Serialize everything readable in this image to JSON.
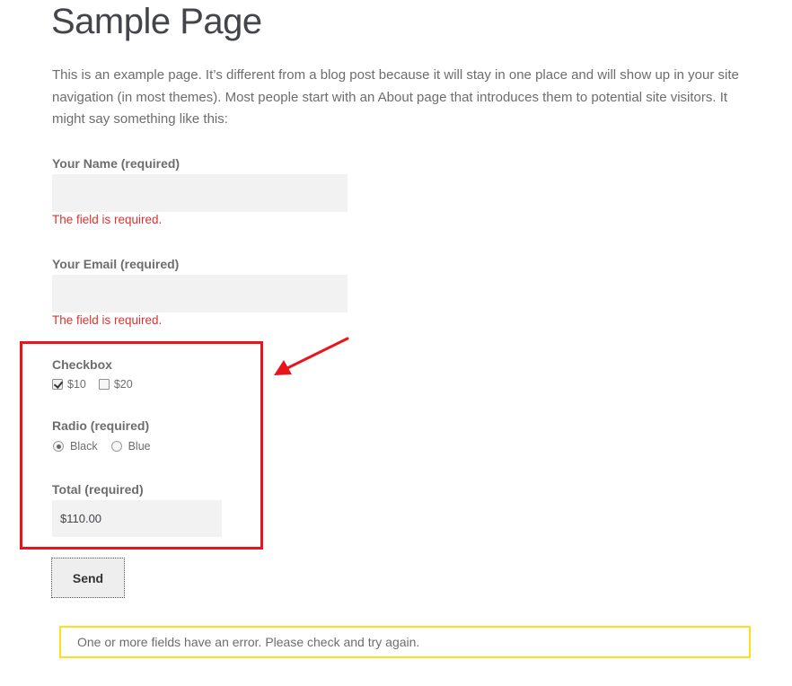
{
  "page": {
    "title": "Sample Page",
    "intro": "This is an example page. It’s different from a blog post because it will stay in one place and will show up in your site navigation (in most themes). Most people start with an About page that introduces them to potential site visitors. It might say something like this:"
  },
  "form": {
    "name": {
      "label": "Your Name (required)",
      "value": "",
      "error": "The field is required."
    },
    "email": {
      "label": "Your Email (required)",
      "value": "",
      "error": "The field is required."
    },
    "checkbox": {
      "label": "Checkbox",
      "options": [
        {
          "label": "$10",
          "checked": true
        },
        {
          "label": "$20",
          "checked": false
        }
      ]
    },
    "radio": {
      "label": "Radio (required)",
      "options": [
        {
          "label": "Black",
          "checked": true
        },
        {
          "label": "Blue",
          "checked": false
        }
      ]
    },
    "total": {
      "label": "Total (required)",
      "value": "$110.00"
    },
    "send_label": "Send",
    "response": "One or more fields have an error. Please check and try again."
  },
  "colors": {
    "error": "#dc3232",
    "highlight": "#e8161c",
    "response_border": "#ffde21"
  }
}
